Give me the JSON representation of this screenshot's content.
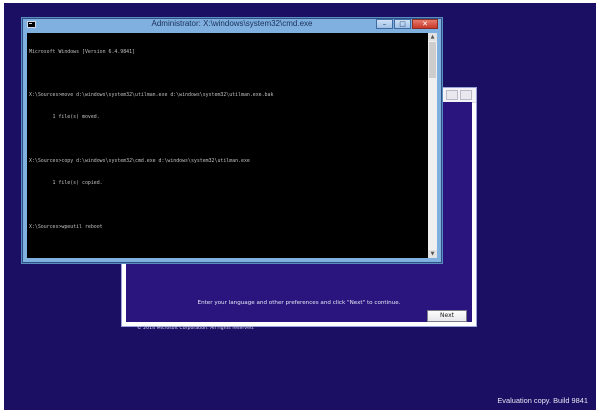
{
  "cmd": {
    "title": "Administrator: X:\\windows\\system32\\cmd.exe",
    "controls": {
      "minimize_glyph": "–",
      "maximize_glyph": "□",
      "close_glyph": "✕"
    },
    "lines": [
      "Microsoft Windows [Version 6.4.9841]",
      "",
      "X:\\Sources>move d:\\windows\\system32\\utilman.exe d:\\windows\\system32\\utilman.exe.bak",
      "        1 file(s) moved.",
      "",
      "X:\\Sources>copy d:\\windows\\system32\\cmd.exe d:\\windows\\system32\\utilman.exe",
      "        1 file(s) copied.",
      "",
      "X:\\Sources>wpeutil reboot"
    ],
    "scroll_up_glyph": "▲",
    "scroll_down_glyph": "▼"
  },
  "setup": {
    "instruction": "Enter your language and other preferences and click \"Next\" to continue.",
    "copyright": "© 2014 Microsoft Corporation. All rights reserved.",
    "next_label": "Next"
  },
  "watermark": "Evaluation copy. Build 9841",
  "colors": {
    "desktop_bg": "#1b0f63",
    "setup_bg": "#2a157e",
    "cmd_frame": "#7fb0e0",
    "console_bg": "#000000",
    "console_text": "#c0c0c0"
  }
}
